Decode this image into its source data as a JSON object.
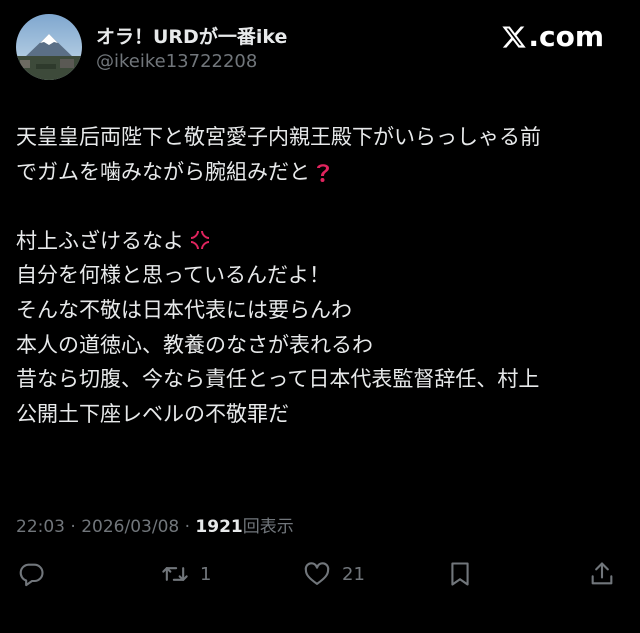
{
  "author": {
    "display_name": "オラ！URDが一番ike",
    "handle": "@ikeike13722208"
  },
  "brand": {
    "label": ".com",
    "logo_icon": "x-logo-icon"
  },
  "tweet": {
    "lines": [
      "天皇皇后両陛下と敬宮愛子内親王殿下がいらっしゃる前",
      "でガムを噛みながら腕組みだと",
      "",
      "村上ふざけるなよ",
      "自分を何様と思っているんだよ！",
      "そんな不敬は日本代表には要らんわ",
      "本人の道徳心、教養のなさが表れるわ",
      "昔なら切腹、今なら責任とって日本代表監督辞任、村上",
      "公開土下座レベルの不敬罪だ"
    ],
    "emojis": {
      "line_2": "red-question-mark-icon",
      "line_4": "anger-symbol-icon"
    }
  },
  "meta": {
    "time": "22:03",
    "separator": "·",
    "date": "2026/03/08",
    "views_count": "1921",
    "views_label": "回表示"
  },
  "actions": {
    "reply_icon": "reply-icon",
    "retweet_icon": "retweet-icon",
    "retweet_count": "1",
    "like_icon": "heart-icon",
    "like_count": "21",
    "bookmark_icon": "bookmark-icon",
    "share_icon": "share-icon"
  },
  "colors": {
    "background": "#000000",
    "text": "#e7e9ea",
    "muted": "#71767b",
    "emoji_red": "#e0245e"
  }
}
